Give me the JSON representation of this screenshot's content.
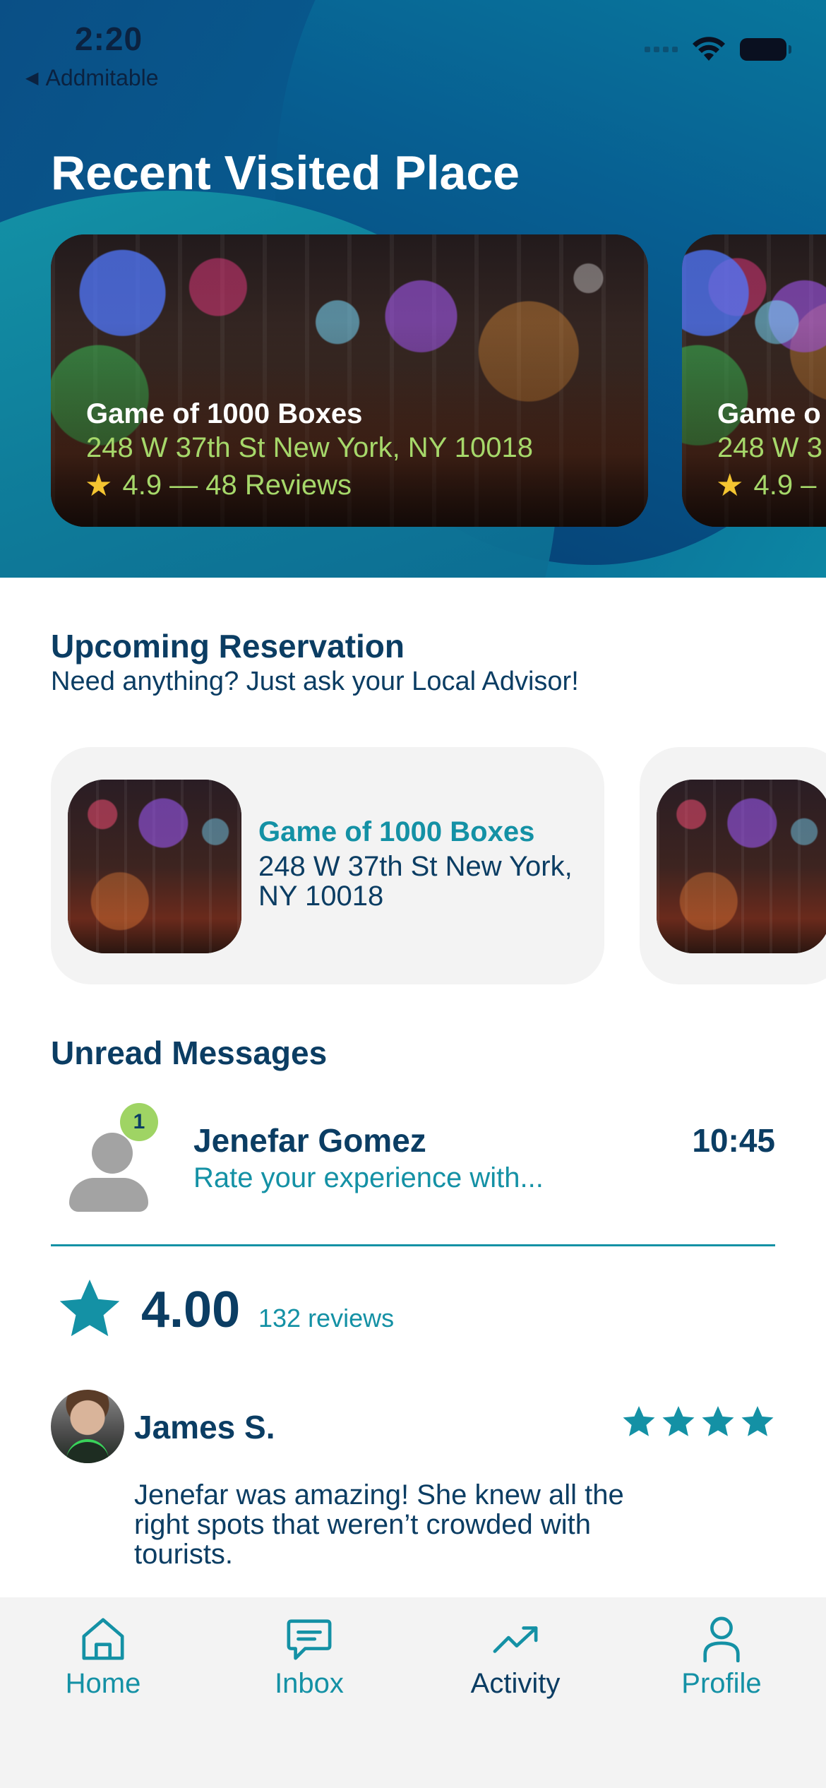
{
  "status_bar": {
    "time": "2:20",
    "back_app": "Addmitable"
  },
  "header": {
    "title": "Recent Visited Place"
  },
  "recent_places": [
    {
      "name": "Game of 1000 Boxes",
      "address": "248 W 37th St New York, NY 10018",
      "rating_text": "4.9 — 48 Reviews"
    },
    {
      "name": "Game o",
      "address": "248 W 3",
      "rating_text": "4.9 –"
    }
  ],
  "upcoming": {
    "title": "Upcoming Reservation",
    "subtitle": "Need anything? Just ask your Local Advisor!",
    "card": {
      "name": "Game of 1000 Boxes",
      "address": "248 W 37th St New York, NY 10018"
    }
  },
  "messages": {
    "title": "Unread Messages",
    "item": {
      "sender": "Jenefar Gomez",
      "preview": "Rate your experience with...",
      "time": "10:45",
      "unread_count": "1"
    }
  },
  "rating": {
    "value": "4.00",
    "count_label": "132 reviews"
  },
  "review": {
    "author": "James S.",
    "stars": 4,
    "text": "Jenefar was amazing! She knew all the right spots that weren’t crowded with tourists."
  },
  "tabbar": {
    "items": [
      {
        "label": "Home",
        "icon": "home-icon"
      },
      {
        "label": "Inbox",
        "icon": "message-icon"
      },
      {
        "label": "Activity",
        "icon": "trending-up-icon",
        "active": true
      },
      {
        "label": "Profile",
        "icon": "person-icon"
      }
    ]
  },
  "colors": {
    "primary_dark": "#0b3d63",
    "accent_teal": "#1491a5",
    "accent_green": "#a6d86a",
    "badge_green": "#9fd464",
    "card_bg": "#f3f3f3"
  }
}
